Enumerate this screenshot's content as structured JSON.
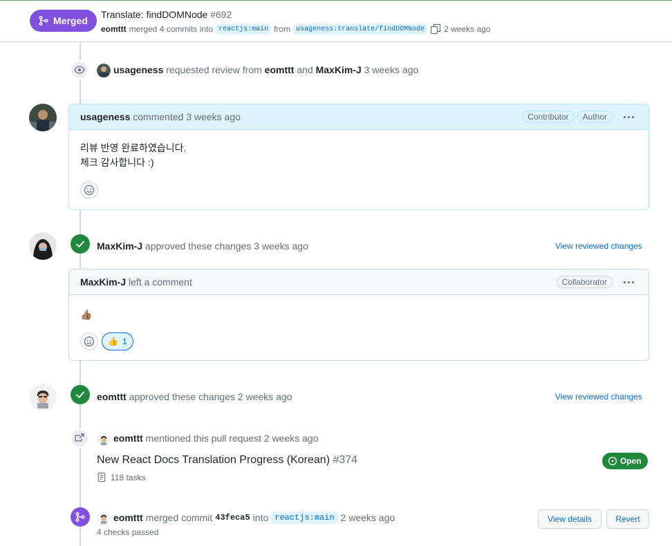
{
  "header": {
    "status_label": "Merged",
    "title": "Translate: findDOMNode",
    "number": "#692",
    "author": "eomttt",
    "merged_text": "merged 4 commits into",
    "base_branch": "reactjs:main",
    "from_text": "from",
    "head_branch": "usageness:translate/findDOMNode",
    "time": "2 weeks ago"
  },
  "timeline": {
    "review_request": {
      "actor": "usageness",
      "text": "requested review from",
      "reviewer1": "eomttt",
      "and": "and",
      "reviewer2": "MaxKim-J",
      "time": "3 weeks ago"
    },
    "comment1": {
      "author": "usageness",
      "action": "commented",
      "time": "3 weeks ago",
      "badges": [
        "Contributor",
        "Author"
      ],
      "body_line1": "리뷰 반영 완료하였습니다.",
      "body_line2": "체크 감사합니다 :)"
    },
    "approval1": {
      "actor": "MaxKim-J",
      "text": "approved these changes",
      "time": "3 weeks ago",
      "link": "View reviewed changes"
    },
    "comment2": {
      "author": "MaxKim-J",
      "action": "left a comment",
      "badge": "Collaborator",
      "body": "👍🏽",
      "reaction_emoji": "👍",
      "reaction_count": "1"
    },
    "approval2": {
      "actor": "eomttt",
      "text": "approved these changes",
      "time": "2 weeks ago",
      "link": "View reviewed changes"
    },
    "mention": {
      "actor": "eomttt",
      "text": "mentioned this pull request",
      "time": "2 weeks ago",
      "issue_title": "New React Docs Translation Progress (Korean)",
      "issue_number": "#374",
      "tasks": "118 tasks",
      "status": "Open"
    },
    "merge": {
      "actor": "eomttt",
      "text": "merged commit",
      "commit": "43feca5",
      "into": "into",
      "branch": "reactjs:main",
      "time": "2 weeks ago",
      "checks": "4 checks passed",
      "view_details": "View details",
      "revert": "Revert"
    }
  },
  "colors": {
    "merged_purple": "#8250df",
    "approved_green": "#1f883d",
    "link_blue": "#0969da",
    "comment_header_blue": "#ddf4ff"
  }
}
